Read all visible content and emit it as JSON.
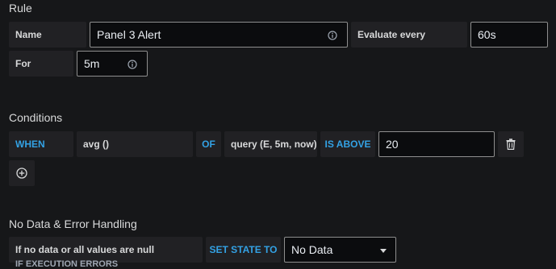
{
  "rule": {
    "heading": "Rule",
    "name_label": "Name",
    "name_value": "Panel 3 Alert",
    "evaluate_label": "Evaluate every",
    "evaluate_value": "60s",
    "for_label": "For",
    "for_value": "5m"
  },
  "conditions": {
    "heading": "Conditions",
    "when": "WHEN",
    "reducer": "avg ()",
    "of": "OF",
    "query": "query (E, 5m, now)",
    "evaluator": "IS ABOVE",
    "threshold": "20"
  },
  "nodata": {
    "heading": "No Data & Error Handling",
    "if_label": "If no data or all values are null",
    "set_state": "SET STATE TO",
    "state_value": "No Data",
    "cut_off_text": "IF EXECUTION ERRORS"
  },
  "icons": {
    "info": "info-icon",
    "trash": "trash-icon",
    "add": "plus-circle-icon",
    "caret": "caret-down-icon"
  }
}
